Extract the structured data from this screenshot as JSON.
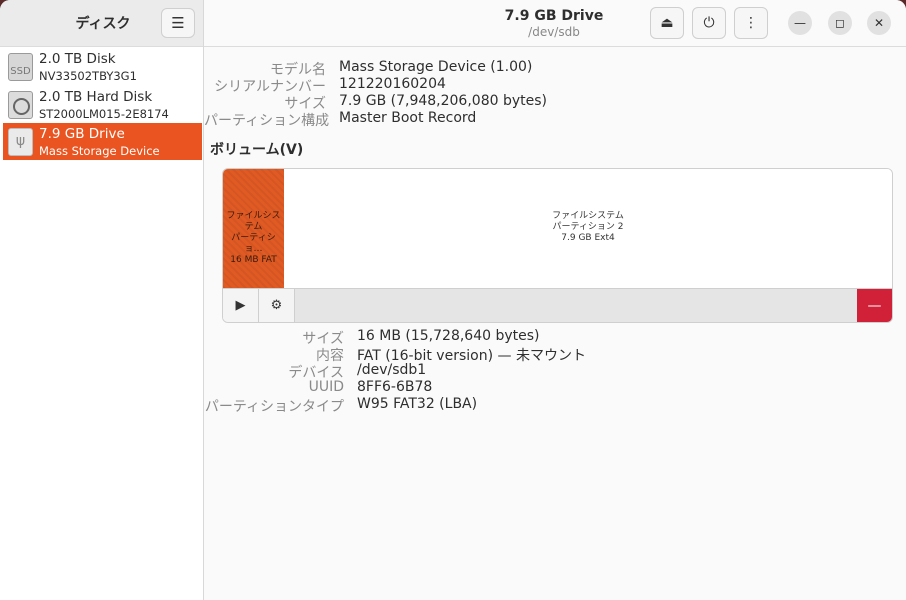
{
  "sidebar": {
    "title": "ディスク",
    "menu_icon": "hamburger-menu-icon",
    "disks": [
      {
        "name": "2.0 TB Disk",
        "model": "NV33502TBY3G1",
        "icon": "ssd-icon",
        "icon_text": "SSD"
      },
      {
        "name": "2.0 TB Hard Disk",
        "model": "ST2000LM015-2E8174",
        "icon": "hdd-icon"
      },
      {
        "name": "7.9 GB Drive",
        "model": "Mass Storage Device",
        "icon": "usb-drive-icon",
        "selected": true
      }
    ]
  },
  "header": {
    "title": "7.9 GB Drive",
    "subtitle": "/dev/sdb"
  },
  "drive_props": [
    {
      "label": "モデル名",
      "value": "Mass Storage Device (1.00)"
    },
    {
      "label": "シリアルナンバー",
      "value": "121220160204"
    },
    {
      "label": "サイズ",
      "value": "7.9 GB (7,948,206,080 bytes)"
    },
    {
      "label": "パーティション構成",
      "value": "Master Boot Record"
    }
  ],
  "volumes": {
    "section_title": "ボリューム(V)",
    "partitions": [
      {
        "line1": "ファイルシステム",
        "line2": "パーティショ…",
        "line3": "16 MB FAT",
        "selected": true
      },
      {
        "line1": "ファイルシステム",
        "line2": "パーティション 2",
        "line3": "7.9 GB Ext4"
      }
    ]
  },
  "partition_props": [
    {
      "label": "サイズ",
      "value": "16 MB (15,728,640 bytes)"
    },
    {
      "label": "内容",
      "value": "FAT (16-bit version) — 未マウント"
    },
    {
      "label": "デバイス",
      "value": "/dev/sdb1"
    },
    {
      "label": "UUID",
      "value": "8FF6-6B78"
    },
    {
      "label": "パーティションタイプ",
      "value": "W95 FAT32 (LBA)"
    }
  ],
  "colors": {
    "accent": "#e95420",
    "delete": "#d12138"
  }
}
